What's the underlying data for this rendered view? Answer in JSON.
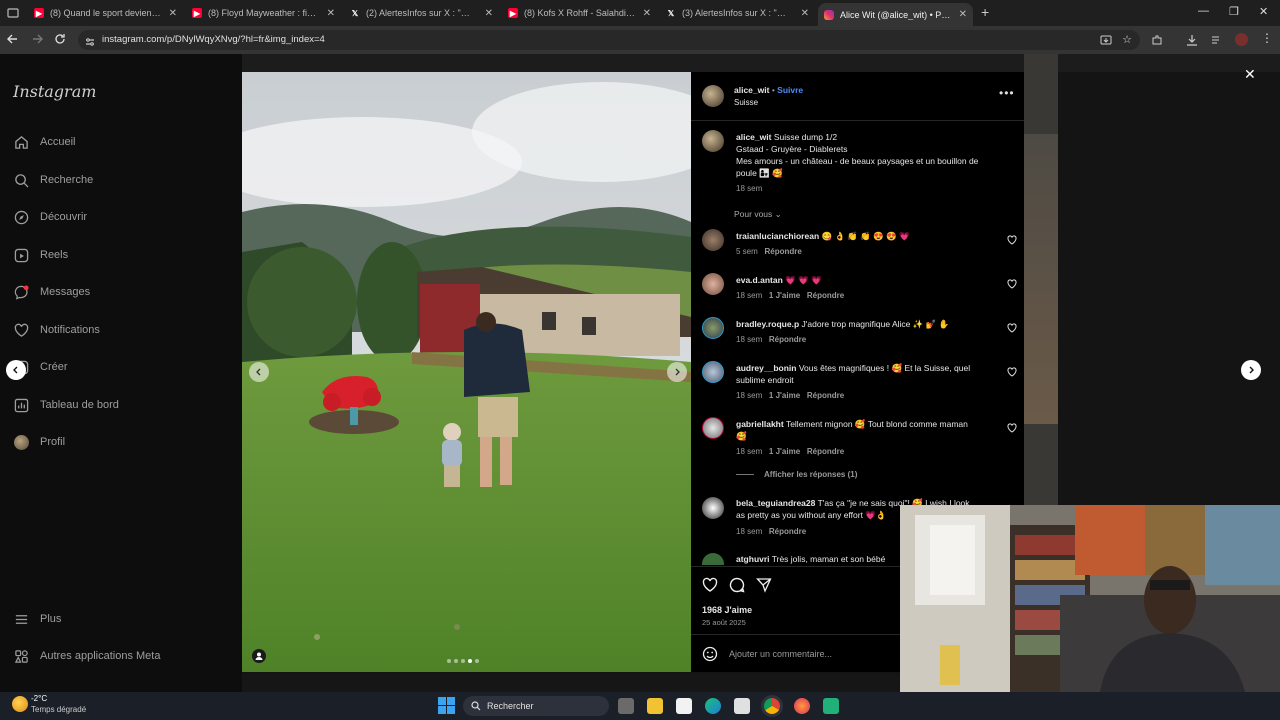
{
  "browser": {
    "tabs": [
      {
        "title": "(8) Quand le sport devient TOX",
        "icon": "youtube-icon"
      },
      {
        "title": "(8) Floyd Mayweather : fin d'un",
        "icon": "youtube-icon"
      },
      {
        "title": "(2) AlertesInfos sur X : \"❌ FLAS",
        "icon": "x-icon"
      },
      {
        "title": "(8) Kofs X Rohff - Salahdine P.",
        "icon": "youtube-icon"
      },
      {
        "title": "(3) AlertesInfos sur X : \"❌ FLAS",
        "icon": "x-icon"
      },
      {
        "title": "Alice Wit (@alice_wit) • Photos",
        "icon": "instagram-icon",
        "active": true
      }
    ],
    "new_tab": "+",
    "url": "instagram.com/p/DNylWqyXNvg/?hl=fr&img_index=4"
  },
  "instagram": {
    "logo": "Instagram",
    "nav": [
      {
        "label": "Accueil",
        "icon": "home-icon"
      },
      {
        "label": "Recherche",
        "icon": "search-icon"
      },
      {
        "label": "Découvrir",
        "icon": "compass-icon"
      },
      {
        "label": "Reels",
        "icon": "reels-icon"
      },
      {
        "label": "Messages",
        "icon": "messenger-icon"
      },
      {
        "label": "Notifications",
        "icon": "heart-icon"
      },
      {
        "label": "Créer",
        "icon": "plus-square-icon"
      },
      {
        "label": "Tableau de bord",
        "icon": "dashboard-icon"
      },
      {
        "label": "Profil",
        "icon": "avatar-icon"
      }
    ],
    "bottom_nav": [
      {
        "label": "Plus",
        "icon": "menu-icon"
      },
      {
        "label": "Autres applications Meta",
        "icon": "meta-apps-icon"
      }
    ]
  },
  "post": {
    "author": "alice_wit",
    "follow": "Suivre",
    "location": "Suisse",
    "caption_lines": [
      "Suisse dump 1/2",
      "Gstaad - Gruyère - Diablerets",
      "Mes amours - un château - de beaux paysages et un bouillon de",
      "poule 👩‍👧 🥰"
    ],
    "caption_time": "18 sem",
    "filter": "Pour vous",
    "comments": [
      {
        "user": "traianlucianchiorean",
        "text": "😋 👌 👏 👏 😍 😍 💗",
        "time": "5 sem",
        "likes": "",
        "reply": "Répondre"
      },
      {
        "user": "eva.d.antan",
        "text": "💗 💗 💗",
        "time": "18 sem",
        "likes": "1 J'aime",
        "reply": "Répondre"
      },
      {
        "user": "bradley.roque.p",
        "text": "J'adore trop magnifique Alice ✨ 💅 ✋",
        "time": "18 sem",
        "likes": "",
        "reply": "Répondre"
      },
      {
        "user": "audrey__bonin",
        "text": "Vous êtes magnifiques ! 🥰 Et la Suisse, quel",
        "text2": "sublime endroit",
        "time": "18 sem",
        "likes": "1 J'aime",
        "reply": "Répondre"
      },
      {
        "user": "gabriellakht",
        "text": "Tellement mignon 🥰 Tout blond comme maman",
        "text2": "🥰",
        "time": "18 sem",
        "likes": "1 J'aime",
        "reply": "Répondre"
      },
      {
        "user": "bela_teguiandrea28",
        "text": "T'as ça \"je ne sais quoi\"! 🥰 I wish I look",
        "text2": "as pretty as you without any effort 💗👌",
        "time": "18 sem",
        "likes": "",
        "reply": "Répondre"
      },
      {
        "user": "atghuvri",
        "text": "Très jolis, maman et son bébé",
        "time": "",
        "likes": "",
        "reply": ""
      }
    ],
    "show_replies": "Afficher les réponses (1)",
    "likes": "1968 J'aime",
    "date": "25 août 2025",
    "add_comment": "Ajouter un commentaire..."
  },
  "taskbar": {
    "weather_temp": "-2°C",
    "weather_desc": "Temps dégradé",
    "search": "Rechercher"
  },
  "colors": {
    "accent": "#4d8df5",
    "bg": "#000000",
    "youtube": "#ff0033",
    "instagram": "#e1306c"
  }
}
